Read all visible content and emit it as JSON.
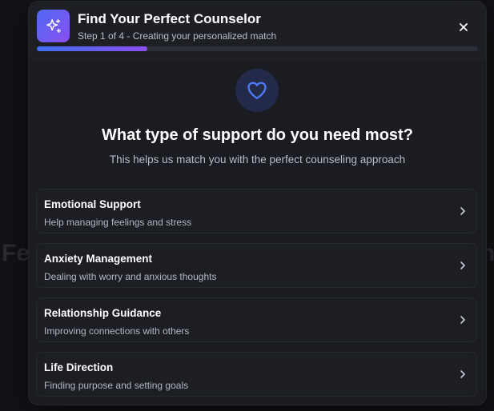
{
  "modal": {
    "title": "Find Your Perfect Counselor",
    "subtitle": "Step 1 of 4 - Creating your personalized match",
    "progress_fraction": 0.25,
    "app_icon": "sparkles-icon",
    "close_icon": "close-icon"
  },
  "question": {
    "icon": "heart-icon",
    "title": "What type of support do you need most?",
    "helper": "This helps us match you with the perfect counseling approach"
  },
  "options": [
    {
      "title": "Emotional Support",
      "description": "Help managing feelings and stress",
      "icon": "chevron-right-icon"
    },
    {
      "title": "Anxiety Management",
      "description": "Dealing with worry and anxious thoughts",
      "icon": "chevron-right-icon"
    },
    {
      "title": "Relationship Guidance",
      "description": "Improving connections with others",
      "icon": "chevron-right-icon"
    },
    {
      "title": "Life Direction",
      "description": "Finding purpose and setting goals",
      "icon": "chevron-right-icon"
    }
  ],
  "colors": {
    "accent_start": "#3f6ff2",
    "accent_end": "#8c4ff0",
    "heart": "#4c7cf6",
    "modal_bg": "#1a1c21"
  }
}
